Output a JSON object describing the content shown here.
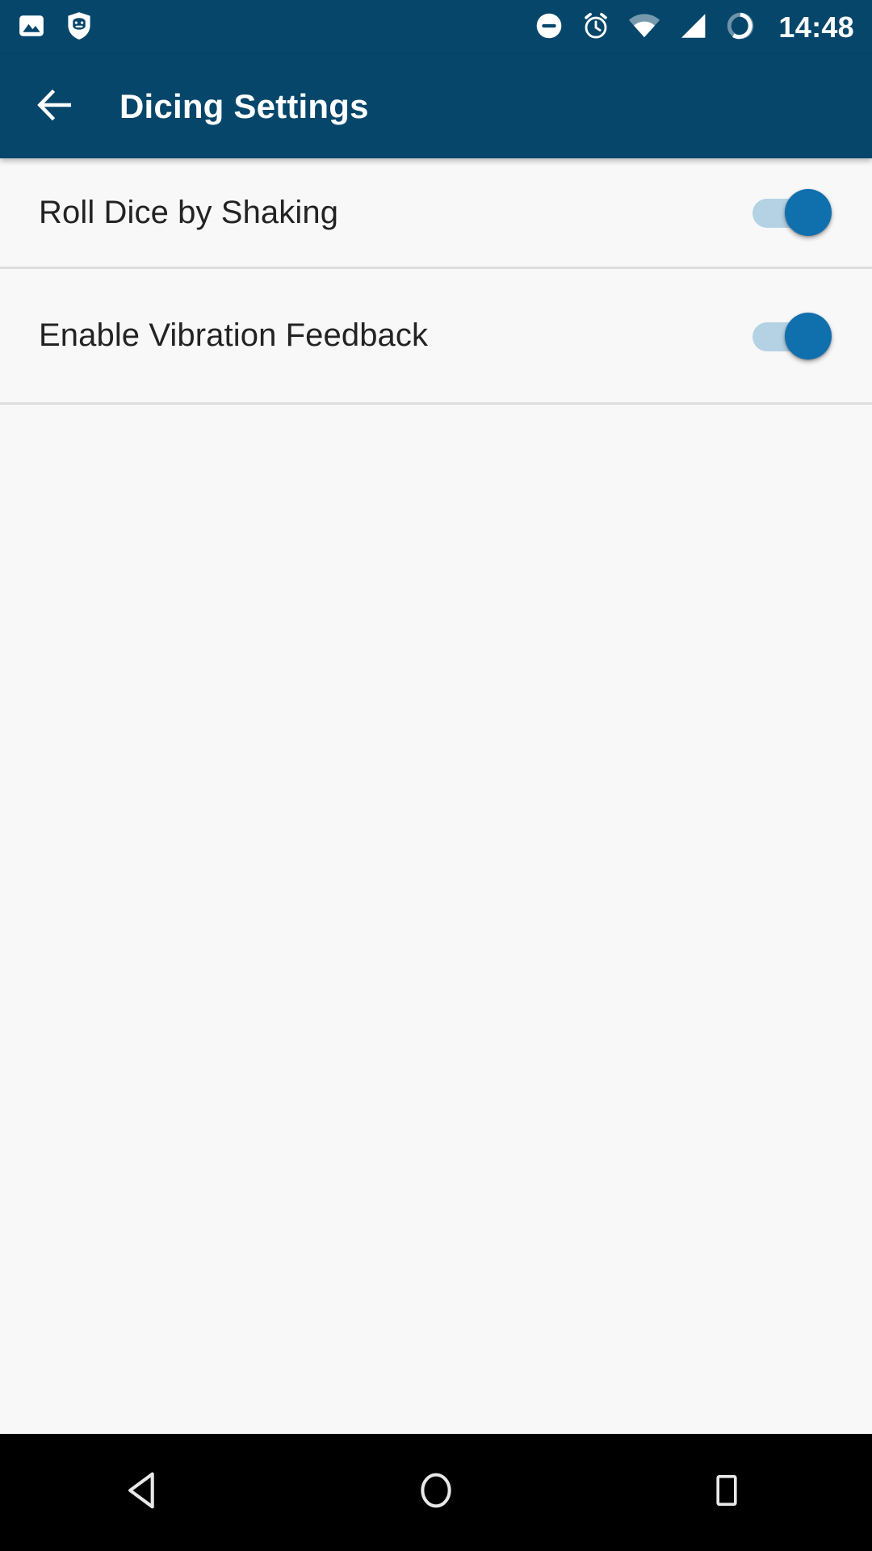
{
  "status_bar": {
    "time": "14:48",
    "left_icons": [
      {
        "name": "photo-image-icon",
        "label": "Screenshot saved"
      },
      {
        "name": "cyanogenmod-shield-icon",
        "label": "CyanogenMod"
      }
    ],
    "right_icons": [
      {
        "name": "do-not-disturb-icon",
        "label": "Do not disturb"
      },
      {
        "name": "alarm-clock-icon",
        "label": "Alarm set"
      },
      {
        "name": "wifi-icon",
        "label": "Wi-Fi connected"
      },
      {
        "name": "cellular-signal-icon",
        "label": "Mobile signal"
      },
      {
        "name": "battery-circle-icon",
        "label": "Battery"
      }
    ]
  },
  "app_bar": {
    "title": "Dicing Settings",
    "back_icon": "arrow-back-icon",
    "background_color": "#06466a",
    "title_color": "#ffffff"
  },
  "settings": {
    "items": [
      {
        "title": "Roll Dice by Shaking",
        "switch_state": "on",
        "switch_label": "On"
      },
      {
        "title": "Enable Vibration Feedback",
        "switch_state": "on",
        "switch_label": "On"
      }
    ],
    "colors": {
      "background": "#f8f8f8",
      "text": "#232323",
      "divider": "#dedede",
      "switch_track_on": "#b4d2e4",
      "switch_thumb_on": "#1070ae"
    }
  },
  "nav_bar": {
    "background_color": "#000000",
    "buttons": [
      {
        "name": "nav-back-button",
        "icon": "triangle-back-icon",
        "label": "Back"
      },
      {
        "name": "nav-home-button",
        "icon": "circle-home-icon",
        "label": "Home"
      },
      {
        "name": "nav-recents-button",
        "icon": "square-recents-icon",
        "label": "Recents"
      }
    ]
  }
}
